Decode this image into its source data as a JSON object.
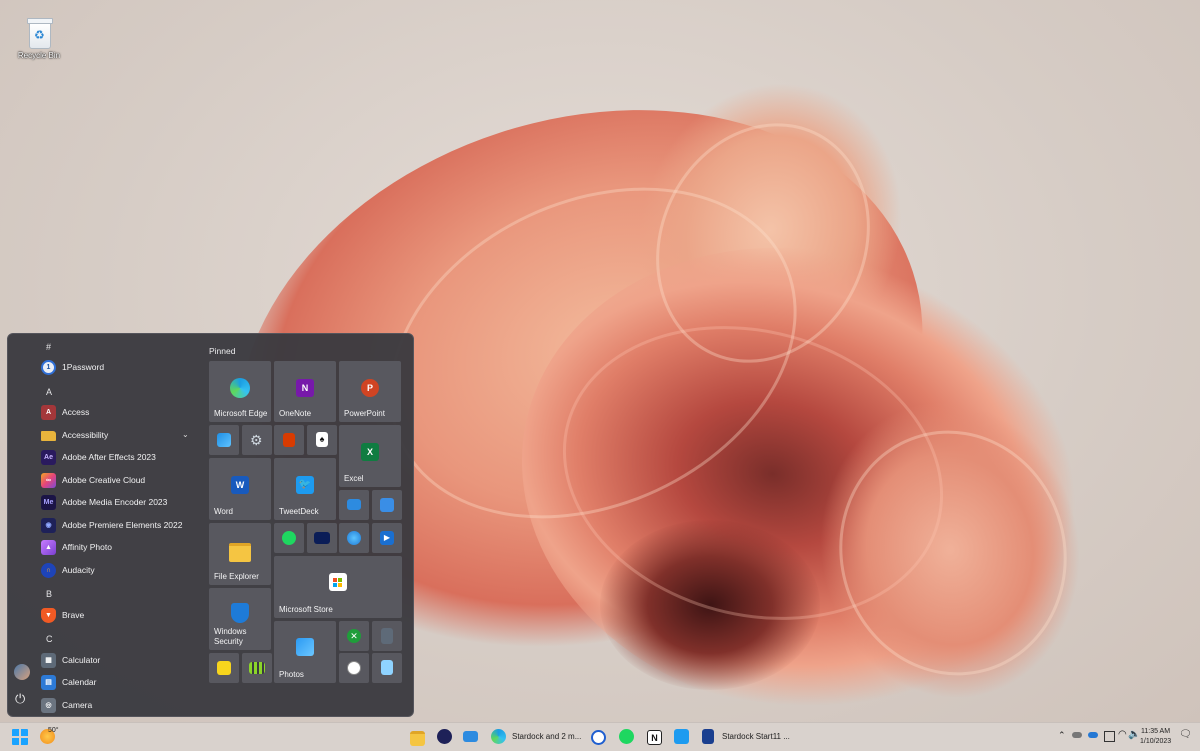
{
  "desktop": {
    "recycle_bin_label": "Recycle Bin"
  },
  "start_menu": {
    "pinned_title": "Pinned",
    "apps": [
      {
        "type": "letter",
        "label": "#"
      },
      {
        "type": "app",
        "label": "1Password",
        "icon": "1password-icon",
        "color": "#e9eef6"
      },
      {
        "type": "letter",
        "label": "A"
      },
      {
        "type": "app",
        "label": "Access",
        "icon": "access-icon",
        "color": "#a4373a",
        "glyph": "A"
      },
      {
        "type": "app",
        "label": "Accessibility",
        "icon": "folder-icon",
        "color": "#e8b43c",
        "folder": true
      },
      {
        "type": "app",
        "label": "Adobe After Effects 2023",
        "icon": "after-effects-icon",
        "color": "#2a1a5e",
        "glyph": "Ae"
      },
      {
        "type": "app",
        "label": "Adobe Creative Cloud",
        "icon": "creative-cloud-icon",
        "color": "#e6457a"
      },
      {
        "type": "app",
        "label": "Adobe Media Encoder 2023",
        "icon": "media-encoder-icon",
        "color": "#1b1446",
        "glyph": "Me"
      },
      {
        "type": "app",
        "label": "Adobe Premiere Elements 2022",
        "icon": "premiere-elements-icon",
        "color": "#1e2158"
      },
      {
        "type": "app",
        "label": "Affinity Photo",
        "icon": "affinity-photo-icon",
        "color": "#9a5ad6"
      },
      {
        "type": "app",
        "label": "Audacity",
        "icon": "audacity-icon",
        "color": "#1e44b8"
      },
      {
        "type": "letter",
        "label": "B"
      },
      {
        "type": "app",
        "label": "Brave",
        "icon": "brave-icon",
        "color": "#f15a24"
      },
      {
        "type": "letter",
        "label": "C"
      },
      {
        "type": "app",
        "label": "Calculator",
        "icon": "calculator-icon",
        "color": "#5e6a78"
      },
      {
        "type": "app",
        "label": "Calendar",
        "icon": "calendar-icon",
        "color": "#2d7ad6"
      },
      {
        "type": "app",
        "label": "Camera",
        "icon": "camera-icon",
        "color": "#6b7480"
      }
    ],
    "tiles": {
      "edge": "Microsoft Edge",
      "onenote": "OneNote",
      "powerpoint": "PowerPoint",
      "excel": "Excel",
      "word": "Word",
      "tweetdeck": "TweetDeck",
      "file_explorer": "File Explorer",
      "store": "Microsoft Store",
      "security_line1": "Windows",
      "security_line2": "Security",
      "photos": "Photos"
    }
  },
  "taskbar": {
    "weather_temp": "50°",
    "edge_window": "Stardock and 2 m...",
    "start11_window": "Stardock Start11 ...",
    "clock_time": "11:35 AM",
    "clock_date": "1/10/2023"
  }
}
